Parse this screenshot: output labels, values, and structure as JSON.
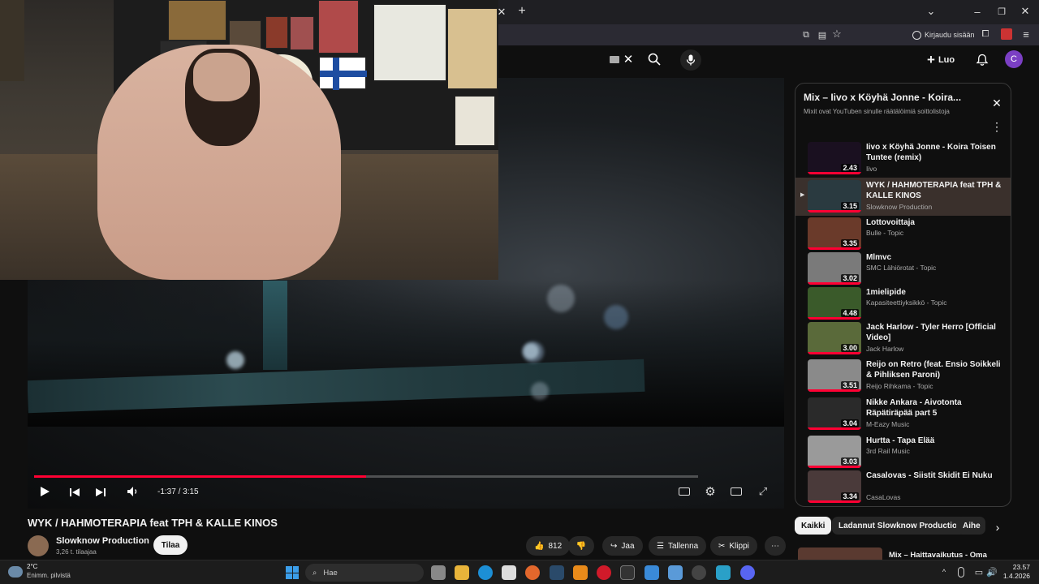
{
  "browser": {
    "signin_label": "Kirjaudu sisään",
    "profile_letter": "C"
  },
  "header": {
    "create_label": "Luo",
    "avatar_letter": "C"
  },
  "player": {
    "time": "-1:37 / 3:15",
    "progress": 0.5
  },
  "video": {
    "title": "WYK / HAHMOTERAPIA feat TPH & KALLE KINOS",
    "channel": "Slowknow Production",
    "subscribers": "3,26 t. tilaajaa",
    "subscribe_label": "Tilaa",
    "likes": "812",
    "share_label": "Jaa",
    "save_label": "Tallenna",
    "clip_label": "Klippi"
  },
  "playlist": {
    "title": "Mix – Iivo x Köyhä Jonne - Koira...",
    "subtitle": "Mixit ovat YouTuben sinulle räätälöimiä soittolistoja",
    "items": [
      {
        "title": "Iivo x Köyhä Jonne - Koira Toisen Tuntee (remix)",
        "channel": "Iivo",
        "duration": "2.43",
        "color": "#1a1020"
      },
      {
        "title": "WYK / HAHMOTERAPIA feat TPH & KALLE KINOS",
        "channel": "Slowknow Production",
        "duration": "3.15",
        "color": "#2a3a40"
      },
      {
        "title": "Lottovoittaja",
        "channel": "Bulle - Topic",
        "duration": "3.35",
        "color": "#6a3a2a"
      },
      {
        "title": "Mlmvc",
        "channel": "SMC Lähiörotat - Topic",
        "duration": "3.02",
        "color": "#7a7a7a"
      },
      {
        "title": "1mielipide",
        "channel": "Kapasiteettiyksikkö - Topic",
        "duration": "4.48",
        "color": "#3a5a2a"
      },
      {
        "title": "Jack Harlow - Tyler Herro [Official Video]",
        "channel": "Jack Harlow",
        "duration": "3.00",
        "color": "#5a6a3a"
      },
      {
        "title": "Reijo on Retro (feat. Ensio Soikkeli & Pihliksen Paroni)",
        "channel": "Reijo Rihkama - Topic",
        "duration": "3.51",
        "color": "#8a8a8a"
      },
      {
        "title": "Nikke Ankara - Aivotonta Räpätiräpää part 5",
        "channel": "M-Eazy Music",
        "duration": "3.04",
        "color": "#2a2a2a"
      },
      {
        "title": "Hurtta - Tapa Elää",
        "channel": "3rd Rail Music",
        "duration": "3.03",
        "color": "#9a9a9a"
      },
      {
        "title": "Casalovas - Siistit Skidit Ei Nuku",
        "channel": "CasaLovas",
        "duration": "3.34",
        "color": "#4a3a3a"
      }
    ]
  },
  "chips": [
    "Kaikki",
    "Ladannut Slowknow Production",
    "Aihe"
  ],
  "next_mix": "Mix – Haittavaikutus - Oma",
  "taskbar": {
    "weather_temp": "2°C",
    "weather_desc": "Enimm. pilvistä",
    "search_label": "Hae",
    "time": "23.57",
    "date": "1.4.2026"
  }
}
